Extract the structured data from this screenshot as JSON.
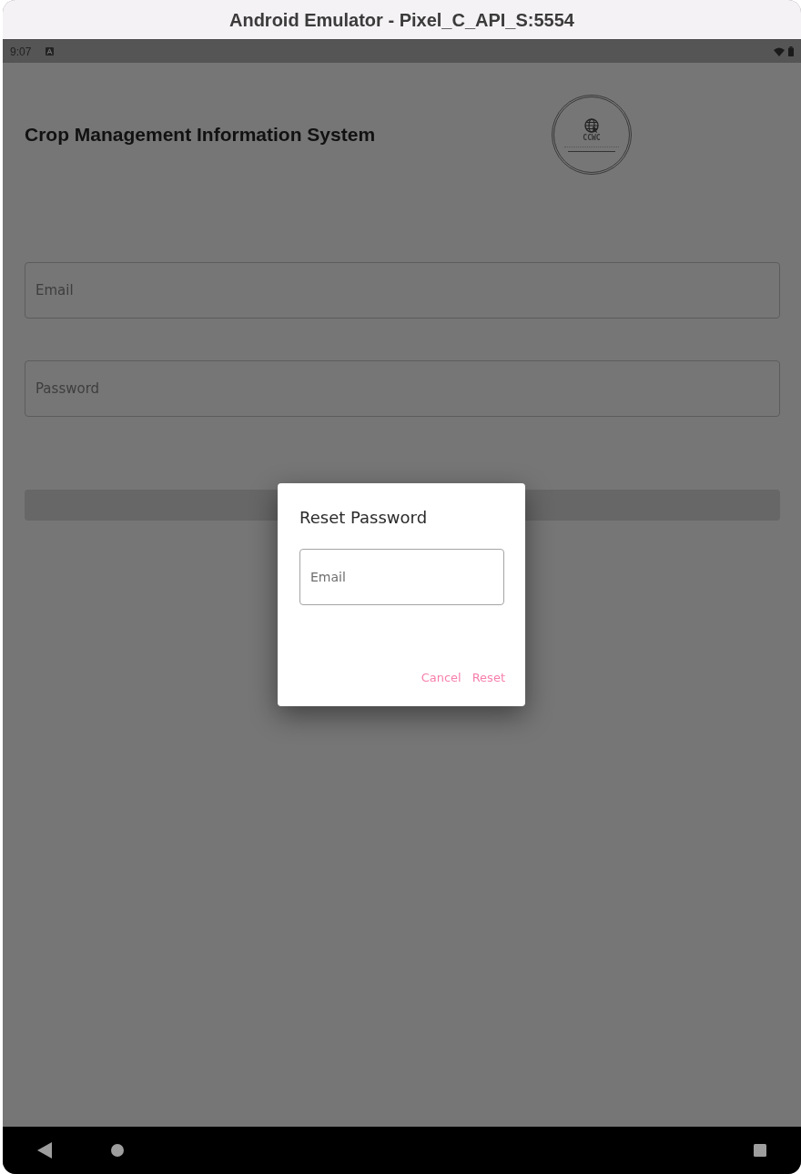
{
  "window": {
    "title": "Android Emulator - Pixel_C_API_S:5554"
  },
  "status_bar": {
    "time": "9:07"
  },
  "login_screen": {
    "title": "Crop Management Information System",
    "logo": {
      "text": "CCWC"
    },
    "fields": [
      {
        "placeholder": "Email"
      },
      {
        "placeholder": "Password"
      }
    ]
  },
  "dialog": {
    "title": "Reset Password",
    "field": {
      "placeholder": "Email"
    },
    "buttons": [
      "Cancel",
      "Reset"
    ]
  }
}
